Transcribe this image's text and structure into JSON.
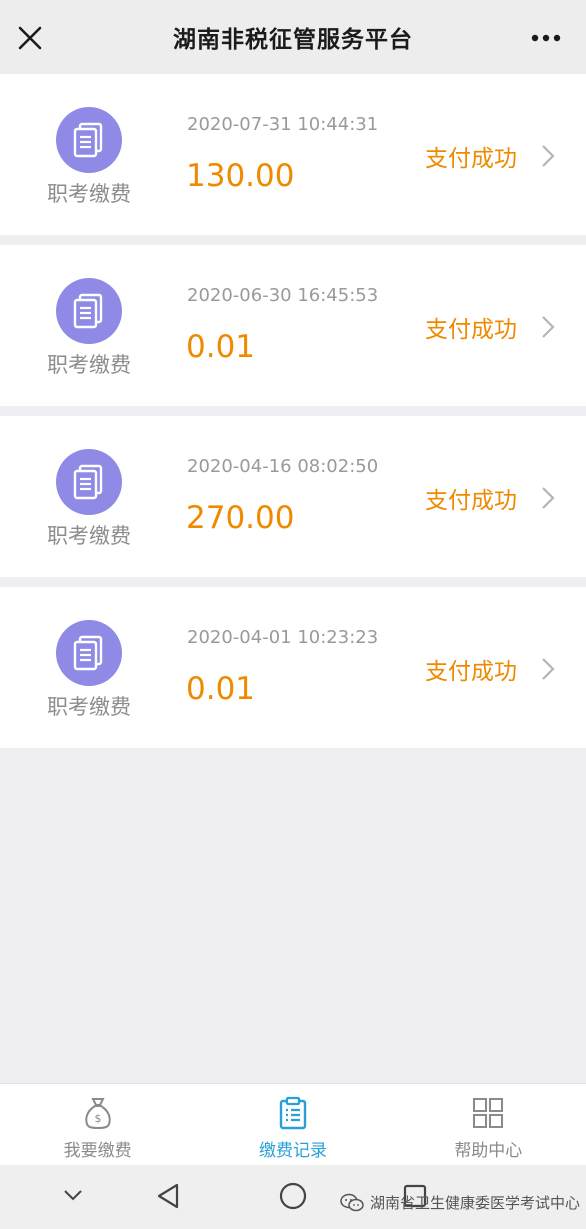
{
  "header": {
    "title": "湖南非税征管服务平台",
    "close_icon": "close-icon",
    "more_icon": "more-dots-icon"
  },
  "records": [
    {
      "category": "职考缴费",
      "time": "2020-07-31 10:44:31",
      "amount": "130.00",
      "status": "支付成功"
    },
    {
      "category": "职考缴费",
      "time": "2020-06-30 16:45:53",
      "amount": "0.01",
      "status": "支付成功"
    },
    {
      "category": "职考缴费",
      "time": "2020-04-16 08:02:50",
      "amount": "270.00",
      "status": "支付成功"
    },
    {
      "category": "职考缴费",
      "time": "2020-04-01 10:23:23",
      "amount": "0.01",
      "status": "支付成功"
    }
  ],
  "tabs": [
    {
      "label": "我要缴费",
      "icon": "money-bag-icon",
      "active": false
    },
    {
      "label": "缴费记录",
      "icon": "clipboard-list-icon",
      "active": true
    },
    {
      "label": "帮助中心",
      "icon": "grid-icon",
      "active": false
    }
  ],
  "watermark": "湖南省卫生健康委医学考试中心",
  "colors": {
    "accent_orange": "#ef8a00",
    "active_tab": "#2aa0d8",
    "badge_purple": "#8e8ae6"
  }
}
